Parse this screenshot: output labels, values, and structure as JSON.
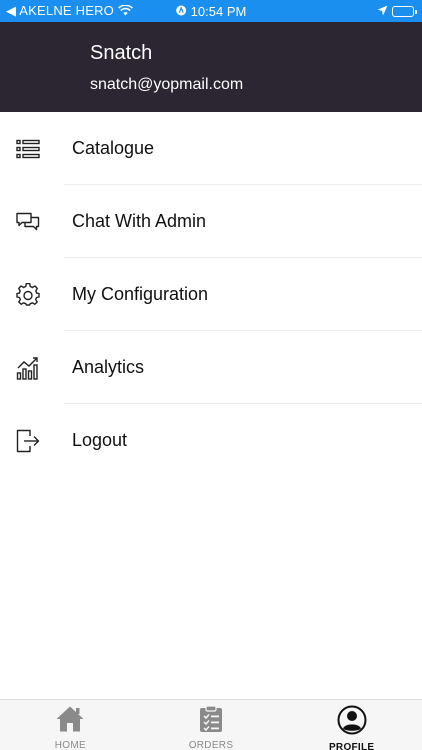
{
  "status_bar": {
    "carrier": "◀ AKELNE HERO",
    "time": "10:54 PM"
  },
  "profile": {
    "name": "Snatch",
    "email": "snatch@yopmail.com"
  },
  "menu": {
    "items": [
      {
        "label": "Catalogue",
        "icon": "list-icon"
      },
      {
        "label": "Chat With Admin",
        "icon": "chat-icon"
      },
      {
        "label": "My Configuration",
        "icon": "gear-icon"
      },
      {
        "label": "Analytics",
        "icon": "analytics-icon"
      },
      {
        "label": "Logout",
        "icon": "logout-icon"
      }
    ]
  },
  "tabs": [
    {
      "label": "HOME",
      "icon": "home-icon",
      "active": false
    },
    {
      "label": "ORDERS",
      "icon": "clipboard-icon",
      "active": false
    },
    {
      "label": "PROFILE",
      "icon": "user-circle-icon",
      "active": true
    }
  ],
  "colors": {
    "status_bar": "#1a8ff0",
    "header": "#2b2631",
    "tab_bar": "#f6f6f6",
    "inactive_tab": "#8a8a8a"
  }
}
